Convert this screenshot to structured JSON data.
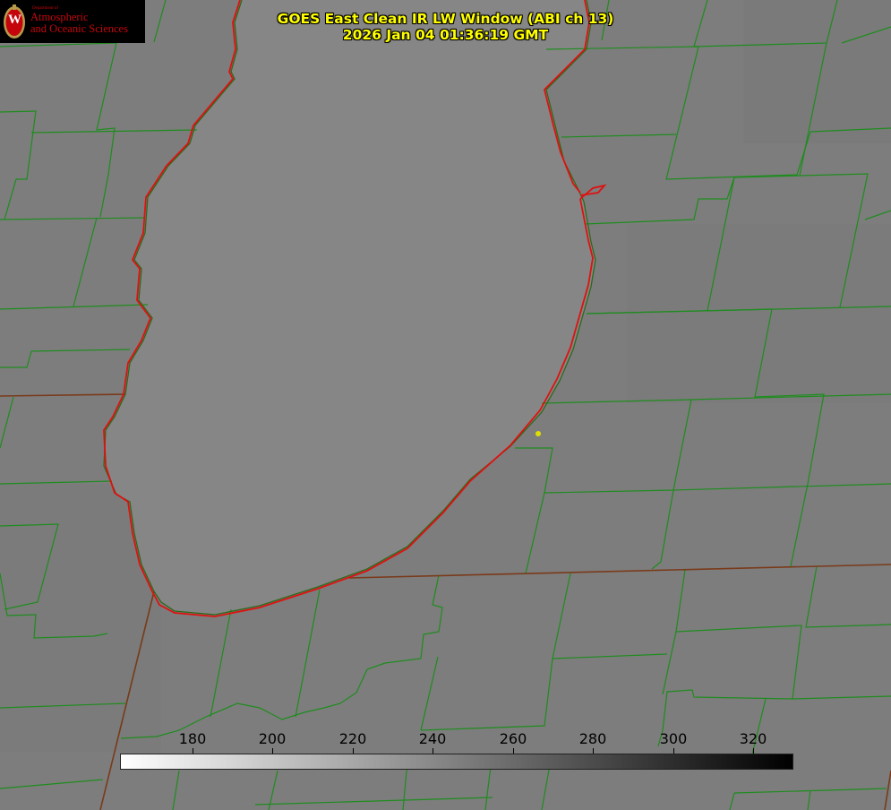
{
  "header": {
    "title_line1": "GOES East Clean IR LW Window (ABI ch 13)",
    "title_line2": "2026 Jan 04 01:36:19 GMT",
    "title_color": "#ffff00"
  },
  "logo": {
    "department": "Department of",
    "line1": "Atmospheric",
    "line2": "and Oceanic Sciences",
    "seal_letter": "W",
    "brand_color": "#c5050c"
  },
  "colorbar": {
    "ticks": [
      {
        "value": 180,
        "label": "180"
      },
      {
        "value": 200,
        "label": "200"
      },
      {
        "value": 220,
        "label": "220"
      },
      {
        "value": 240,
        "label": "240"
      },
      {
        "value": 260,
        "label": "260"
      },
      {
        "value": 280,
        "label": "280"
      },
      {
        "value": 300,
        "label": "300"
      },
      {
        "value": 320,
        "label": "320"
      }
    ],
    "min_value": 162,
    "max_value": 330,
    "start_color": "#ffffff",
    "end_color": "#000000"
  },
  "map": {
    "background_color": "#7d7d7d",
    "lake_color": "#868686",
    "county_line_color": "#1e8c1e",
    "coastline_color": "#e01010",
    "state_line_color": "#7a3a1a",
    "marker_color": "#e0e000"
  }
}
